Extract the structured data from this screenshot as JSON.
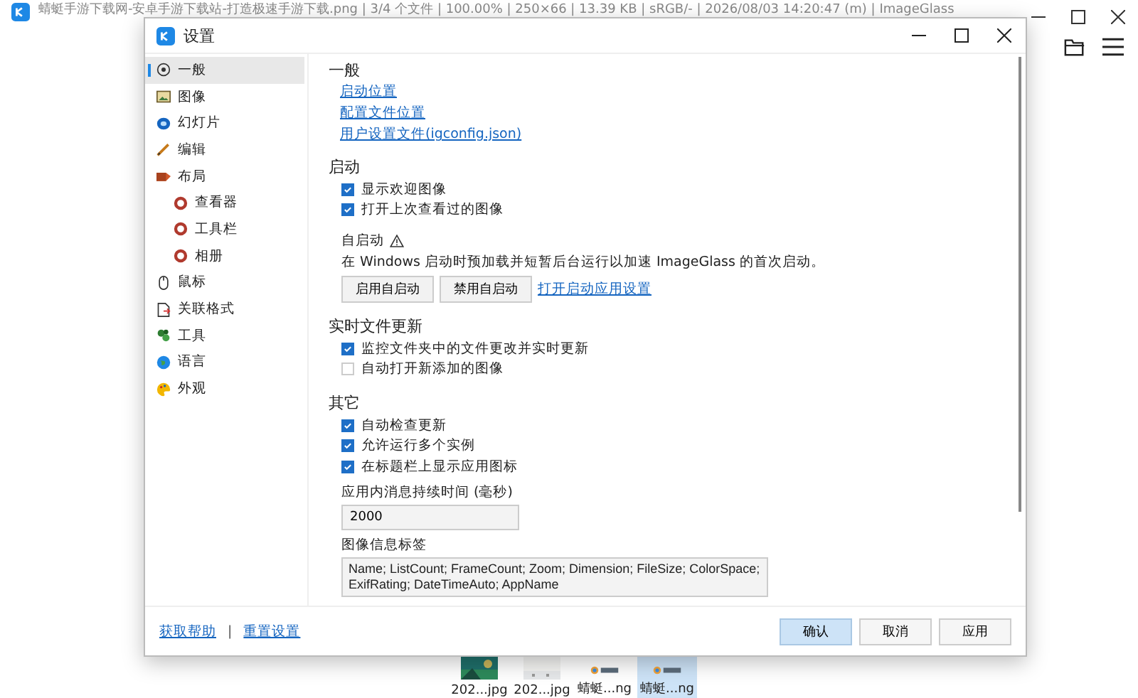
{
  "app": {
    "title": "蜻蜓手游下载网-安卓手游下载站-打造极速手游下载.png  |  3/4 个文件  |  100.00%  |  250×66  |  13.39 KB  |  sRGB/-  |  2026/08/03 14:20:47 (m)  |  ImageGlass",
    "thumbnails": [
      {
        "label": "202...jpg",
        "selected": false
      },
      {
        "label": "202...jpg",
        "selected": false
      },
      {
        "label": "蜻蜓...ng",
        "selected": false
      },
      {
        "label": "蜻蜓...ng",
        "selected": true
      }
    ]
  },
  "dialog": {
    "title": "设置",
    "sidebar": {
      "items": [
        {
          "label": "一般",
          "selected": true
        },
        {
          "label": "图像",
          "selected": false
        },
        {
          "label": "幻灯片",
          "selected": false
        },
        {
          "label": "编辑",
          "selected": false
        },
        {
          "label": "布局",
          "selected": false,
          "children": [
            {
              "label": "查看器",
              "selected": false
            },
            {
              "label": "工具栏",
              "selected": false
            },
            {
              "label": "相册",
              "selected": false
            }
          ]
        },
        {
          "label": "鼠标",
          "selected": false
        },
        {
          "label": "关联格式",
          "selected": false
        },
        {
          "label": "工具",
          "selected": false
        },
        {
          "label": "语言",
          "selected": false
        },
        {
          "label": "外观",
          "selected": false
        }
      ]
    },
    "sections": [
      {
        "heading": "一般",
        "items": [
          {
            "kind": "link",
            "text": "启动位置"
          },
          {
            "kind": "link",
            "text": "配置文件位置"
          },
          {
            "kind": "link",
            "text": "用户设置文件(igconfig.json)"
          }
        ]
      },
      {
        "heading": "启动",
        "items": [
          {
            "kind": "checkbox",
            "label": "显示欢迎图像",
            "checked": true
          },
          {
            "kind": "checkbox",
            "label": "打开上次查看过的图像",
            "checked": true
          },
          {
            "kind": "label",
            "text": "自启动",
            "warning": true
          },
          {
            "kind": "note",
            "text": "在 Windows 启动时预加载并短暂后台运行以加速 ImageGlass 的首次启动。"
          },
          {
            "kind": "buttons",
            "buttons": [
              "启用自启动",
              "禁用自启动"
            ],
            "link": "打开启动应用设置"
          }
        ]
      },
      {
        "heading": "实时文件更新",
        "items": [
          {
            "kind": "checkbox",
            "label": "监控文件夹中的文件更改并实时更新",
            "checked": true
          },
          {
            "kind": "checkbox",
            "label": "自动打开新添加的图像",
            "checked": false
          }
        ]
      },
      {
        "heading": "其它",
        "items": [
          {
            "kind": "checkbox",
            "label": "自动检查更新",
            "checked": true
          },
          {
            "kind": "checkbox",
            "label": "允许运行多个实例",
            "checked": true
          },
          {
            "kind": "checkbox",
            "label": "在标题栏上显示应用图标",
            "checked": true
          },
          {
            "kind": "field",
            "label": "应用内消息持续时间 (毫秒)",
            "value": "2000"
          },
          {
            "kind": "textarea",
            "label": "图像信息标签",
            "value": "Name; ListCount; FrameCount; Zoom; Dimension; FileSize; ColorSpace; ExifRating; DateTimeAuto; AppName"
          }
        ]
      }
    ],
    "footer": {
      "links": [
        "获取帮助",
        "重置设置"
      ],
      "separator": "|",
      "buttons": [
        {
          "label": "确认",
          "selected": true
        },
        {
          "label": "取消",
          "selected": false
        },
        {
          "label": "应用",
          "selected": false
        }
      ]
    }
  }
}
